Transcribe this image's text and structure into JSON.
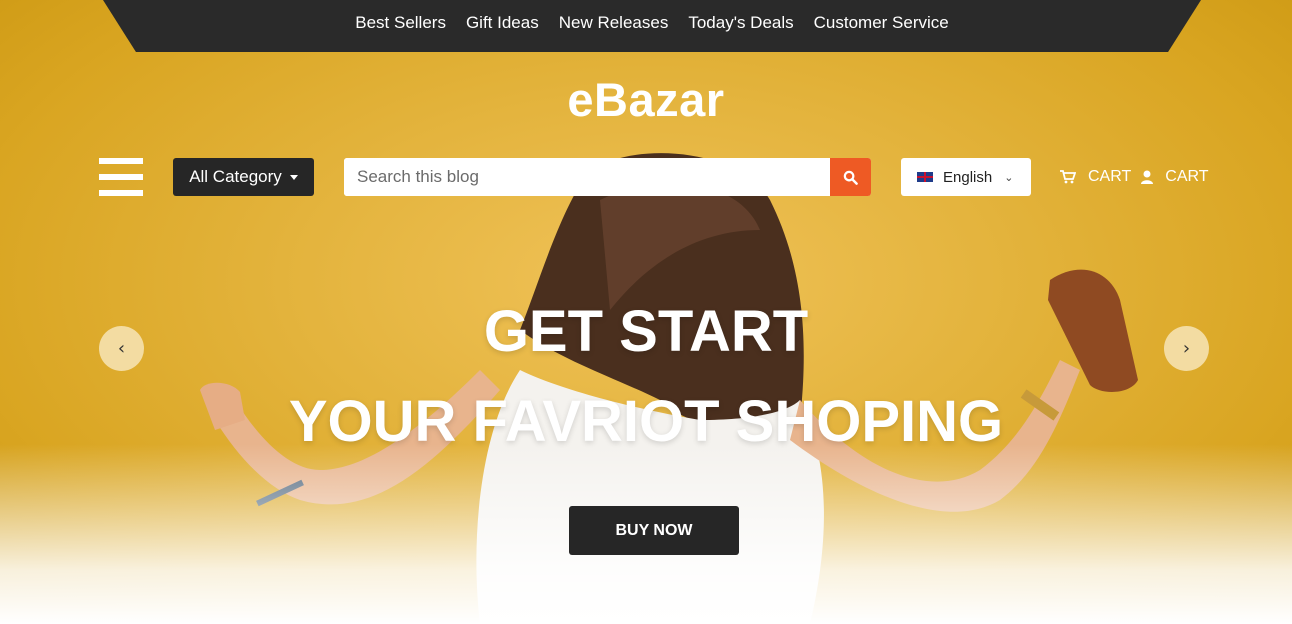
{
  "topnav": {
    "links": [
      "Best Sellers",
      "Gift Ideas",
      "New Releases",
      "Today's Deals",
      "Customer Service"
    ]
  },
  "brand": {
    "logo": "eBazar"
  },
  "header": {
    "category_label": "All Category",
    "search_placeholder": "Search this blog",
    "language": "English",
    "cart_label": "CART",
    "account_label": "CART"
  },
  "hero": {
    "line1": "GET START",
    "line2": "YOUR FAVRIOT SHOPING",
    "cta": "BUY NOW"
  },
  "colors": {
    "accent": "#ee5a24",
    "dark": "#262626",
    "background": "#e3b33c"
  },
  "icons": {
    "menu": "hamburger-menu-icon",
    "search": "search-icon",
    "flag": "uk-flag-icon",
    "chevron": "chevron-down-icon",
    "cart": "shopping-cart-icon",
    "user": "user-icon",
    "prev": "chevron-left-icon",
    "next": "chevron-right-icon"
  }
}
